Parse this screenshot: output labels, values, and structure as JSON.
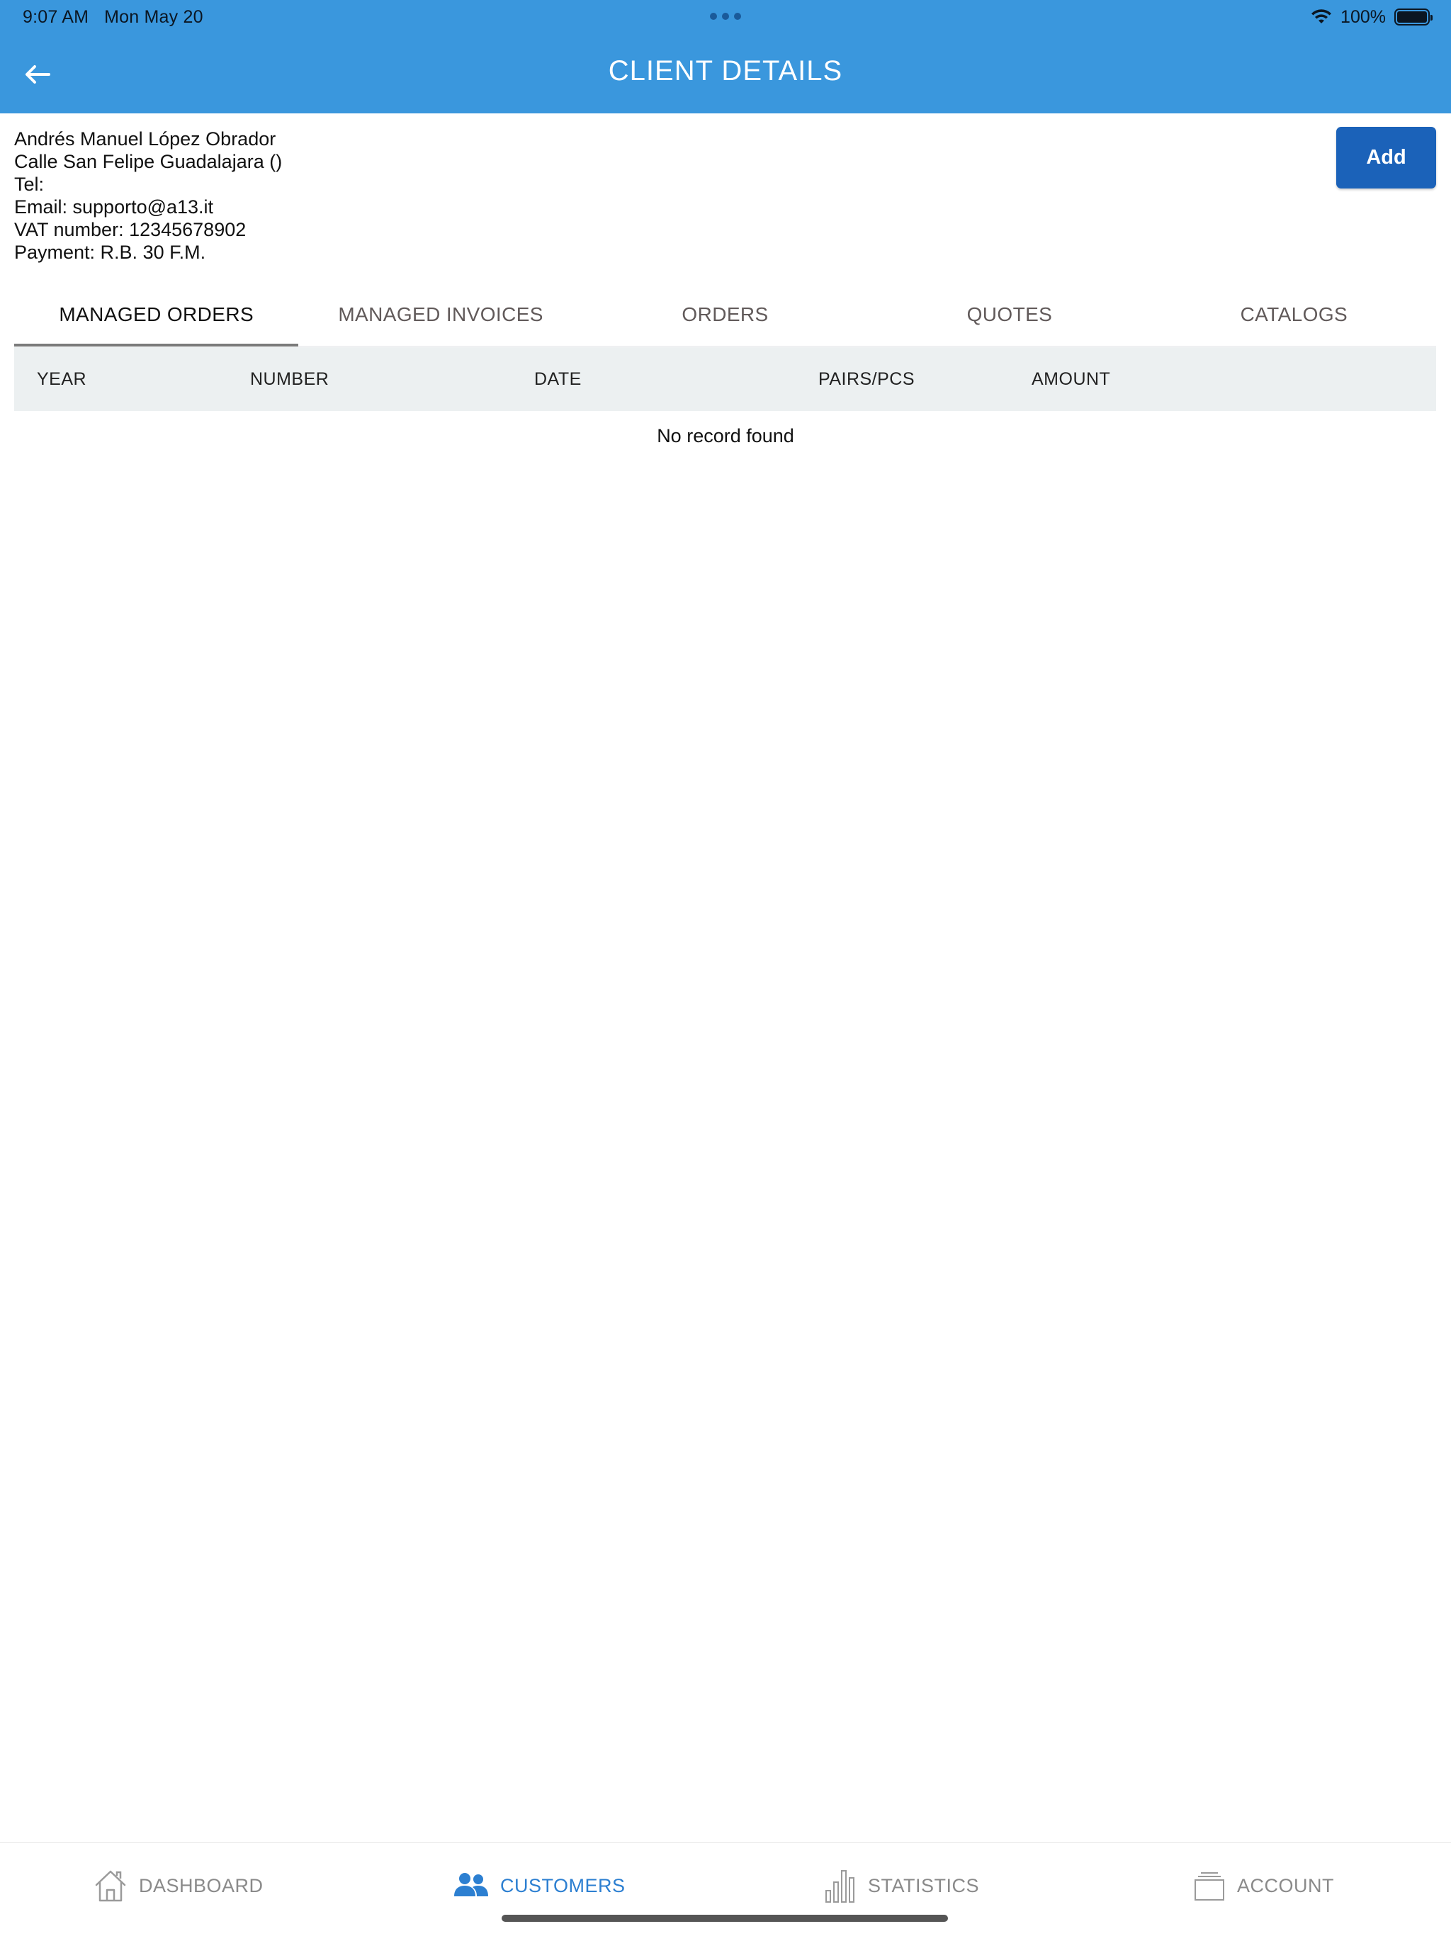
{
  "status_bar": {
    "time": "9:07 AM",
    "date": "Mon May 20",
    "battery": "100%"
  },
  "header": {
    "title": "CLIENT DETAILS",
    "back_icon": "arrow-left-icon"
  },
  "client": {
    "name": "Andrés Manuel López Obrador",
    "address": "Calle San Felipe Guadalajara ()",
    "tel": "Tel:",
    "email": "Email: supporto@a13.it",
    "vat": "VAT number: 12345678902",
    "payment": "Payment: R.B. 30 F.M."
  },
  "actions": {
    "add_label": "Add"
  },
  "tabs": [
    {
      "label": "MANAGED ORDERS"
    },
    {
      "label": "MANAGED INVOICES"
    },
    {
      "label": "ORDERS"
    },
    {
      "label": "QUOTES"
    },
    {
      "label": "CATALOGS"
    }
  ],
  "table": {
    "columns": [
      "YEAR",
      "NUMBER",
      "DATE",
      "PAIRS/PCS",
      "AMOUNT"
    ],
    "empty_message": "No record found"
  },
  "bottom_nav": [
    {
      "label": "DASHBOARD",
      "icon": "home-icon"
    },
    {
      "label": "CUSTOMERS",
      "icon": "users-icon"
    },
    {
      "label": "STATISTICS",
      "icon": "bar-chart-icon"
    },
    {
      "label": "ACCOUNT",
      "icon": "stack-icon"
    }
  ],
  "colors": {
    "header_bg": "#3a97dd",
    "add_button": "#1b62b9",
    "active_nav": "#2c7fd1",
    "table_header_bg": "#ecf0f1"
  }
}
